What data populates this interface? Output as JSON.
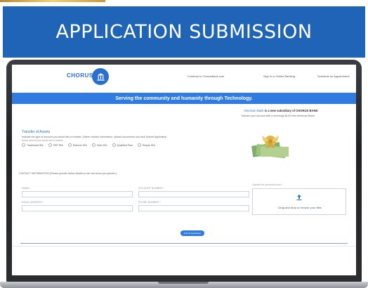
{
  "slide": {
    "title": "APPLICATION SUBMISSION"
  },
  "site": {
    "brand": "CHORUS",
    "nav": [
      {
        "label": "Continue to ChorusBank.com"
      },
      {
        "label": "Sign in to Online Banking"
      },
      {
        "label": "Schedule an Appointment"
      }
    ],
    "service_banner": "Serving the community and humanity through Technology."
  },
  "promo": {
    "headline_link": "American Bank",
    "headline_rest": " is a new subsidiary of CHORUS BANK",
    "subtext": "Transfer your account with a sovereign $100 from American Bank!"
  },
  "transfer": {
    "title": "Transfer of Assets",
    "instructions": "Indicate the type of account you would like to transfer. Gather contact information. Upload documents and click Submit Application.",
    "hint": "Select account you would like to transfer",
    "options": [
      "Traditional IRA",
      "SEP IRA",
      "Rollover IRA",
      "Roth IRA",
      "Qualified Plan",
      "Simple IRA"
    ]
  },
  "contact": {
    "label": "CONTACT INFORMATION (Please provide below details so we can serve you quicker.)",
    "fields": {
      "name": "NAME *",
      "account_number": "ACCOUNT NUMBER *",
      "email": "EMAIL ADDRESS *",
      "phone": "PHONE NUMBER *"
    }
  },
  "upload": {
    "label": "Upload the personal scan *",
    "drop_prefix": "Drag and drop or ",
    "drop_link": "browse",
    "drop_suffix": " your files"
  },
  "actions": {
    "submit": "Submit Application"
  },
  "colors": {
    "banner": "#1f64b6",
    "accent": "#2f7be0",
    "brand": "#2a6fd0"
  }
}
